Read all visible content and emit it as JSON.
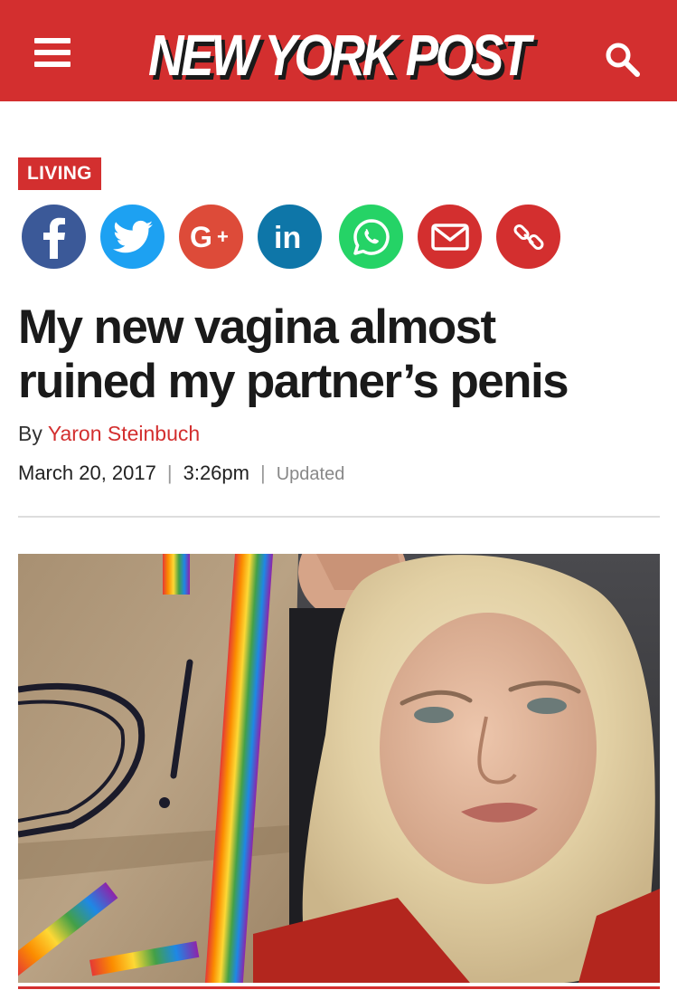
{
  "header": {
    "brand": "NEW YORK POST",
    "menu_icon": "hamburger-menu-icon",
    "search_icon": "search-icon",
    "brand_color": "#d32f2f"
  },
  "article": {
    "section": "LIVING",
    "headline_line1": "My new vagina almost",
    "headline_line2": "ruined my partner’s penis",
    "byline_prefix": "By",
    "author": "Yaron Steinbuch",
    "date": "March 20, 2017",
    "separator": "|",
    "time": "3:26pm",
    "updated": "Updated"
  },
  "share": [
    {
      "name": "facebook",
      "icon": "facebook-icon",
      "color": "#3b5998"
    },
    {
      "name": "twitter",
      "icon": "twitter-icon",
      "color": "#1da1f2"
    },
    {
      "name": "google-plus",
      "icon": "google-plus-icon",
      "color": "#dd4b39"
    },
    {
      "name": "linkedin",
      "icon": "linkedin-icon",
      "color": "#0e76a8"
    },
    {
      "name": "whatsapp",
      "icon": "whatsapp-icon",
      "color": "#25d366"
    },
    {
      "name": "email",
      "icon": "email-icon",
      "color": "#d32f2f"
    },
    {
      "name": "copy-link",
      "icon": "link-icon",
      "color": "#d32f2f"
    }
  ]
}
